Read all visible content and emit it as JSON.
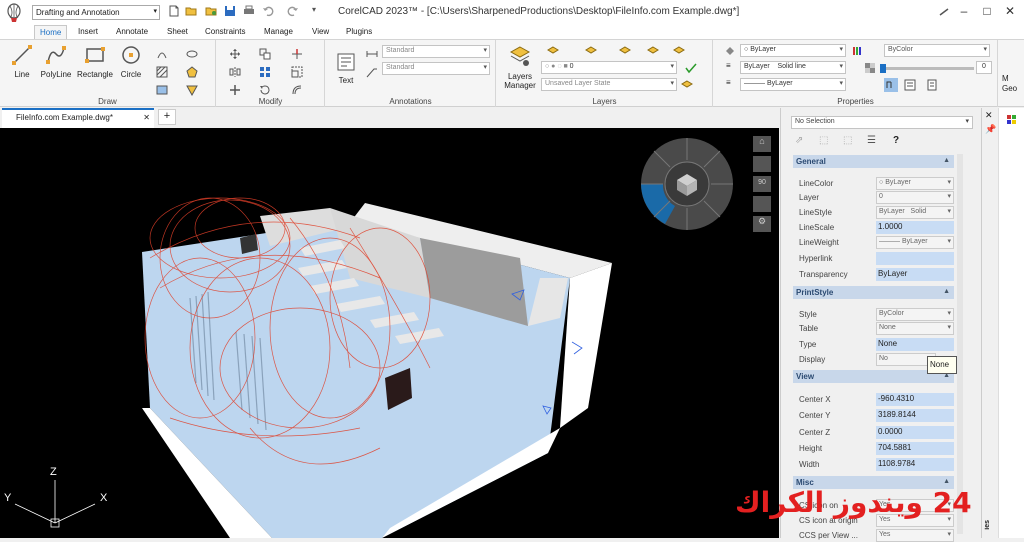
{
  "app": {
    "workspace": "Drafting and Annotation",
    "title": "CorelCAD 2023™ - [C:\\Users\\SharpenedProductions\\Desktop\\FileInfo.com Example.dwg*]"
  },
  "tabs": [
    "Home",
    "Insert",
    "Annotate",
    "Sheet",
    "Constraints",
    "Manage",
    "View",
    "Plugins"
  ],
  "ribbon": {
    "draw": {
      "label": "Draw",
      "line": "Line",
      "polyline": "PolyLine",
      "rectangle": "Rectangle",
      "circle": "Circle"
    },
    "modify": {
      "label": "Modify"
    },
    "annotations": {
      "label": "Annotations",
      "text": "Text",
      "style1": "Standard",
      "style2": "Standard"
    },
    "layers": {
      "label": "Layers",
      "manager_line1": "Layers",
      "manager_line2": "Manager",
      "layer_value": "0",
      "layer_state": "Unsaved Layer State"
    },
    "properties": {
      "label": "Properties",
      "color": "ByLayer",
      "linetype_layer": "ByLayer",
      "linetype": "Solid line",
      "lineweight": "ByLayer",
      "plotstyle": "ByColor",
      "transparency": "0"
    }
  },
  "document": {
    "tab": "FileInfo.com Example.dwg*",
    "add": "+"
  },
  "viewcube": {
    "angle": "90"
  },
  "ucs": {
    "x": "X",
    "y": "Y",
    "z": "Z"
  },
  "properties_panel": {
    "selection": "No Selection",
    "help": "?",
    "general": {
      "title": "General",
      "rows": [
        {
          "label": "LineColor",
          "value": "ByLayer"
        },
        {
          "label": "Layer",
          "value": "0"
        },
        {
          "label": "LineStyle",
          "value": "ByLayer",
          "value2": "Solid"
        },
        {
          "label": "LineScale",
          "value": "1.0000"
        },
        {
          "label": "LineWeight",
          "value": "ByLayer"
        },
        {
          "label": "Hyperlink",
          "value": ""
        },
        {
          "label": "Transparency",
          "value": "ByLayer"
        }
      ]
    },
    "printstyle": {
      "title": "PrintStyle",
      "rows": [
        {
          "label": "Style",
          "value": "ByColor"
        },
        {
          "label": "Table",
          "value": "None"
        },
        {
          "label": "Type",
          "value": "None"
        },
        {
          "label": "Display",
          "value": "No"
        }
      ]
    },
    "view": {
      "title": "View",
      "rows": [
        {
          "label": "Center X",
          "value": "-960.4310"
        },
        {
          "label": "Center Y",
          "value": "3189.8144"
        },
        {
          "label": "Center Z",
          "value": "0.0000"
        },
        {
          "label": "Height",
          "value": "704.5881"
        },
        {
          "label": "Width",
          "value": "1108.9784"
        }
      ]
    },
    "misc": {
      "title": "Misc",
      "rows": [
        {
          "label": "CS icon on",
          "value": "Yes"
        },
        {
          "label": "CS icon at origin",
          "value": "Yes"
        },
        {
          "label": "CCS per View ...",
          "value": "Yes"
        }
      ]
    },
    "tooltip": "None",
    "side_label": "ies"
  },
  "far_right": {
    "line1": "M",
    "line2": "Geo"
  },
  "watermark": "24 ويندوز الكراك",
  "colors": {
    "accent": "#1b6fc4",
    "section": "#c8d7ea",
    "value": "#c8dcf4",
    "viewcube_active": "#1a6aa8"
  }
}
